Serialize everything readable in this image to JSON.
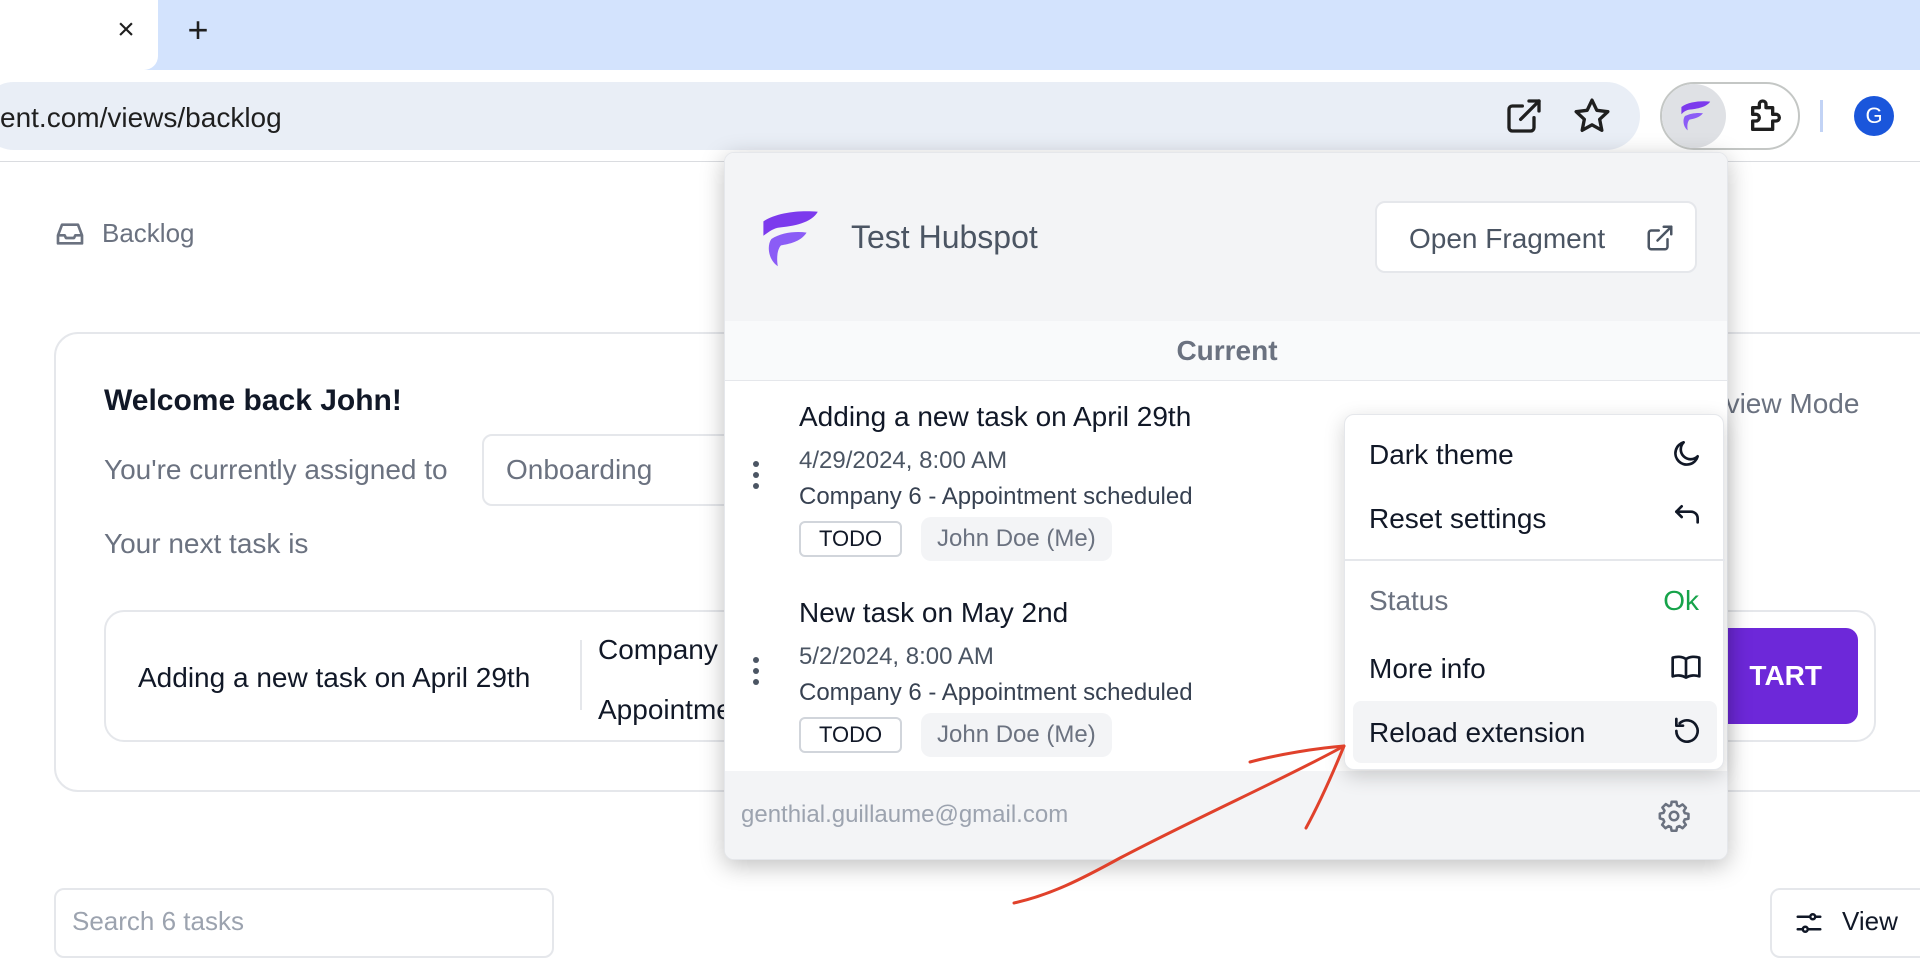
{
  "browser": {
    "url": "ent.com/views/backlog",
    "avatar_letter": "G",
    "close_symbol": "×",
    "new_tab_symbol": "+",
    "brand_color": "#7c3aed"
  },
  "page": {
    "breadcrumb": "Backlog",
    "welcome": "Welcome back John!",
    "assigned_label": "You're currently assigned to",
    "assigned_value": "Onboarding",
    "next_task_label": "Your next task is",
    "next_task_title": "Adding a new task on April 29th",
    "next_task_company": "Company",
    "next_task_appt": "Appointme",
    "start_label": "TART",
    "review_mode": "eview Mode",
    "search_placeholder": "Search 6 tasks",
    "view_label": "View"
  },
  "popup": {
    "title": "Test Hubspot",
    "open_fragment": "Open Fragment",
    "section": "Current",
    "tasks": [
      {
        "title": "Adding a new task on April 29th",
        "date": "4/29/2024, 8:00 AM",
        "company": "Company 6 - Appointment scheduled",
        "status": "TODO",
        "assignee": "John Doe (Me)"
      },
      {
        "title": "New task on May 2nd",
        "date": "5/2/2024, 8:00 AM",
        "company": "Company 6 - Appointment scheduled",
        "status": "TODO",
        "assignee": "John Doe (Me)"
      }
    ],
    "footer_email": "genthial.guillaume@gmail.com"
  },
  "menu": {
    "dark_theme": "Dark theme",
    "reset_settings": "Reset settings",
    "status_label": "Status",
    "status_value": "Ok",
    "status_color": "#16a34a",
    "more_info": "More info",
    "reload_extension": "Reload extension"
  },
  "icons": {
    "tab_close": "close-icon",
    "new_tab": "plus-icon",
    "open_external": "external-link-icon",
    "bookmark": "star-icon",
    "extension_logo": "fragment-logo-icon",
    "extensions": "puzzle-icon",
    "dark_theme": "moon-icon",
    "reset": "undo-icon",
    "more_info": "book-icon",
    "reload": "reload-icon",
    "settings": "gear-icon",
    "task_menu": "kebab-icon"
  },
  "annotation": {
    "arrow_color": "#e0412b"
  }
}
